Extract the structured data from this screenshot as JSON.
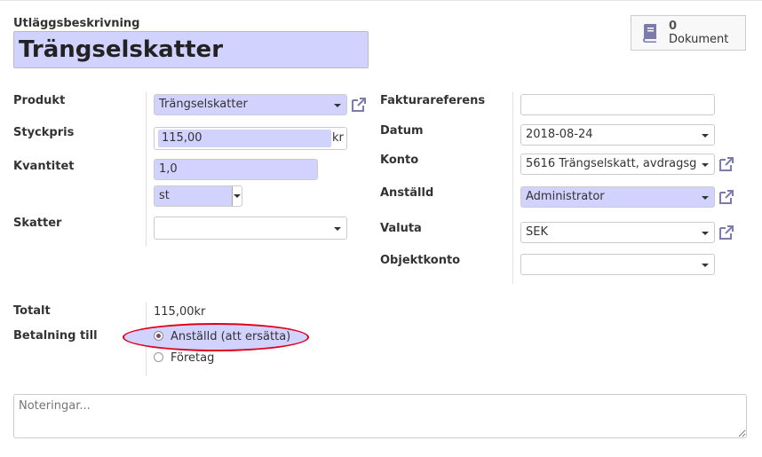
{
  "header": {
    "description_label": "Utläggsbeskrivning",
    "description_value": "Trängselskatter",
    "documents": {
      "count": "0",
      "label": "Dokument"
    }
  },
  "left": {
    "product": {
      "label": "Produkt",
      "value": "Trängselskatter"
    },
    "unit_price": {
      "label": "Styckpris",
      "value": "115,00",
      "currency": "kr"
    },
    "quantity": {
      "label": "Kvantitet",
      "value": "1,0",
      "uom": "st"
    },
    "taxes": {
      "label": "Skatter",
      "value": ""
    }
  },
  "right": {
    "invoice_ref": {
      "label": "Fakturareferens",
      "value": ""
    },
    "date": {
      "label": "Datum",
      "value": "2018-08-24"
    },
    "account": {
      "label": "Konto",
      "value": "5616 Trängselskatt, avdragsg"
    },
    "employee": {
      "label": "Anställd",
      "value": "Administrator"
    },
    "currency": {
      "label": "Valuta",
      "value": "SEK"
    },
    "analytic": {
      "label": "Objektkonto",
      "value": ""
    }
  },
  "totals": {
    "total_label": "Totalt",
    "total_value": "115,00kr",
    "payment_label": "Betalning till",
    "options": [
      {
        "label": "Anställd (att ersätta)",
        "selected": true
      },
      {
        "label": "Företag",
        "selected": false
      }
    ]
  },
  "notes": {
    "placeholder": "Noteringar..."
  },
  "colors": {
    "required_bg": "#d2d2ff",
    "highlight_ring": "#e0001a",
    "link_icon": "#7c7bad"
  }
}
